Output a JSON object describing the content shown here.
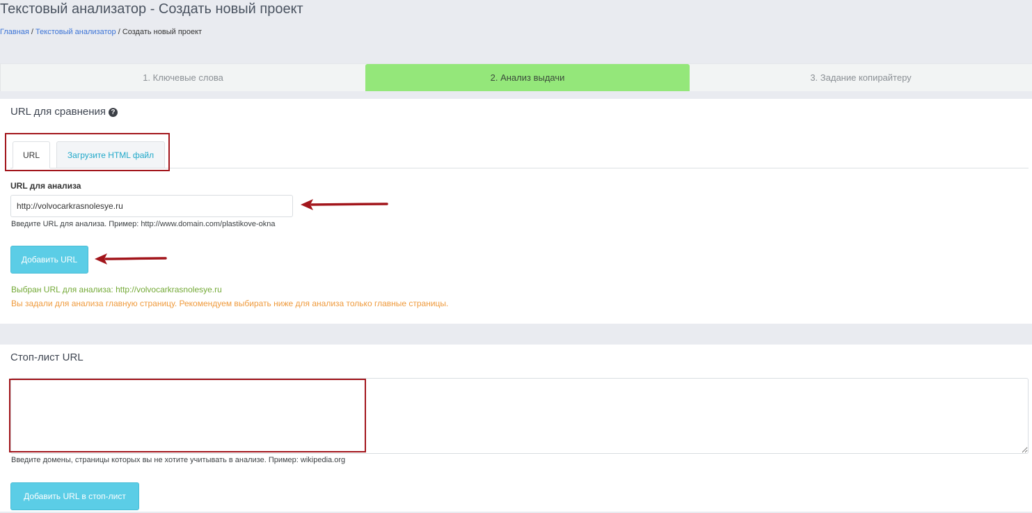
{
  "header": {
    "title": "Текстовый анализатор - Создать новый проект",
    "breadcrumb": {
      "home": "Главная",
      "sep1": " / ",
      "parent": "Текстовый анализатор",
      "sep2": " / ",
      "current": "Создать новый проект"
    }
  },
  "steps": [
    {
      "label": "1. Ключевые слова",
      "active": false
    },
    {
      "label": "2. Анализ выдачи",
      "active": true
    },
    {
      "label": "3. Задание копирайтеру",
      "active": false
    }
  ],
  "compare": {
    "title": "URL для сравнения",
    "help_icon": "question-circle-icon",
    "tabs": [
      {
        "label": "URL",
        "active": true
      },
      {
        "label": "Загрузите HTML файл",
        "active": false
      }
    ],
    "field_label": "URL для анализа",
    "url_value": "http://volvocarkrasnolesye.ru",
    "hint": "Введите URL для анализа. Пример: http://www.domain.com/plastikove-okna",
    "add_button": "Добавить URL",
    "selected_msg": "Выбран URL для анализа: http://volvocarkrasnolesye.ru",
    "warning_msg": "Вы задали для анализа главную страницу. Рекомендуем выбирать ниже для анализа только главные страницы."
  },
  "stoplist": {
    "title": "Стоп-лист URL",
    "textarea_value": "",
    "hint": "Введите домены, страницы которых вы не хотите учитывать в анализе. Пример: wikipedia.org",
    "add_button": "Добавить URL в стоп-лист"
  },
  "colors": {
    "active_step": "#94e77a",
    "button": "#5bcde6",
    "annotation": "#a2151b",
    "success_text": "#73a936",
    "warning_text": "#ef9a3c",
    "link": "#3b73d6"
  }
}
